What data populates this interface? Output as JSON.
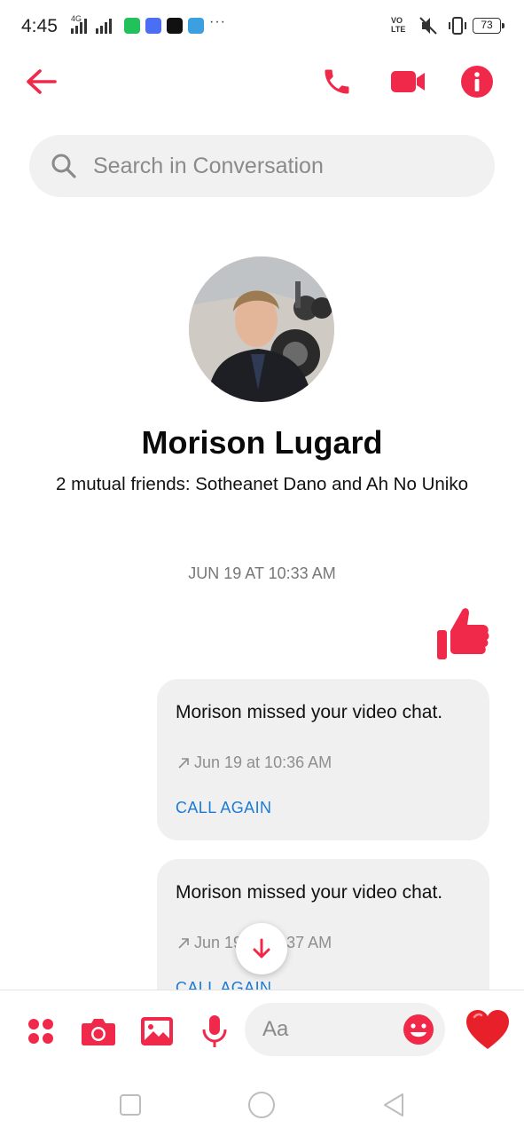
{
  "status_bar": {
    "time": "4:45",
    "network": "4G",
    "volte": "VO\nLTE",
    "battery": "73",
    "battery_level_percent": 73
  },
  "header": {
    "back_icon": "arrow-left-icon",
    "call_icon": "phone-icon",
    "video_icon": "video-camera-icon",
    "info_icon": "info-icon"
  },
  "search": {
    "placeholder": "Search in Conversation"
  },
  "profile": {
    "name": "Morison Lugard",
    "mutual_friends": "2 mutual friends: Sotheanet Dano and Ah No Uniko"
  },
  "conversation": {
    "timestamp": "JUN 19 AT 10:33 AM",
    "messages": [
      {
        "text": "Morison missed your video chat.",
        "time": "Jun 19 at 10:36 AM",
        "action": "CALL AGAIN"
      },
      {
        "text": "Morison missed your video chat.",
        "time": "Jun 19 at 10:37 AM",
        "action": "CALL AGAIN"
      }
    ]
  },
  "composer": {
    "placeholder": "Aa"
  },
  "colors": {
    "accent": "#f02849",
    "link": "#1c7ad6",
    "bubble": "#f0f0f0"
  }
}
